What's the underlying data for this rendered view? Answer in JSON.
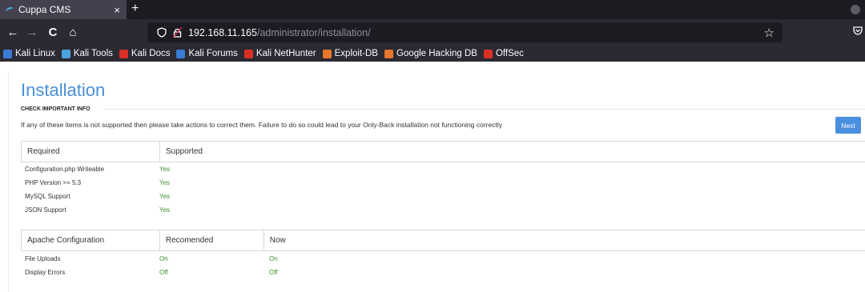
{
  "browser": {
    "tab_title": "Cuppa CMS",
    "tab_close": "×",
    "new_tab": "+",
    "back": "←",
    "forward": "→",
    "reload": "C",
    "home": "⌂",
    "url_host": "192.168.11.165",
    "url_path": "/administrator/installation/",
    "bookmark_star": "☆",
    "bookmarks": [
      {
        "label": "Kali Linux",
        "color": "#3a7bd5"
      },
      {
        "label": "Kali Tools",
        "color": "#4aa3df"
      },
      {
        "label": "Kali Docs",
        "color": "#d93025"
      },
      {
        "label": "Kali Forums",
        "color": "#3a7bd5"
      },
      {
        "label": "Kali NetHunter",
        "color": "#d93025"
      },
      {
        "label": "Exploit-DB",
        "color": "#e8762c"
      },
      {
        "label": "Google Hacking DB",
        "color": "#e8762c"
      },
      {
        "label": "OffSec",
        "color": "#d93025"
      }
    ]
  },
  "page": {
    "title": "Installation",
    "section_label": "CHECK IMPORTANT INFO",
    "info_text": "If any of these items is not supported then please take actions to correct them. Failure to do so could lead to your Only-Back installation not functioning correctly",
    "next_label": "Next",
    "requirements": {
      "headers": [
        "Required",
        "Supported"
      ],
      "rows": [
        {
          "name": "Configuration.php Writeable",
          "supported": "Yes"
        },
        {
          "name": "PHP Version >= 5.3",
          "supported": "Yes"
        },
        {
          "name": "MySQL Support",
          "supported": "Yes"
        },
        {
          "name": "JSON Support",
          "supported": "Yes"
        }
      ]
    },
    "apache": {
      "headers": [
        "Apache Configuration",
        "Recomended",
        "Now"
      ],
      "rows": [
        {
          "name": "File Uploads",
          "recommended": "On",
          "now": "On"
        },
        {
          "name": "Display Errors",
          "recommended": "Off",
          "now": "Off"
        }
      ]
    }
  },
  "colors": {
    "title": "#4a8fd4",
    "status_green": "#3f8f2f",
    "next_button": "#4a8fe0"
  }
}
